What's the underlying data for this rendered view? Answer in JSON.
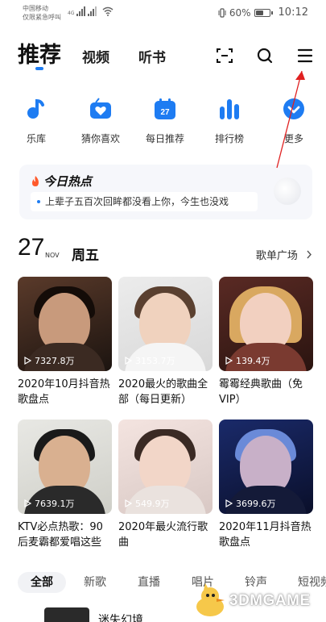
{
  "status_bar": {
    "carrier_line1": "中国移动",
    "carrier_line2": "仅限紧急呼叫",
    "signal_badge": "4G",
    "battery_percent": "60%",
    "time": "10:12"
  },
  "nav": {
    "tabs": [
      {
        "label": "推荐",
        "active": true
      },
      {
        "label": "视频",
        "active": false
      },
      {
        "label": "听书",
        "active": false
      }
    ],
    "icons": [
      "scan-icon",
      "search-icon",
      "menu-icon"
    ]
  },
  "quick_entries": [
    {
      "label": "乐库",
      "icon": "music-note-icon"
    },
    {
      "label": "猜你喜欢",
      "icon": "heart-radio-icon"
    },
    {
      "label": "每日推荐",
      "icon": "calendar-icon",
      "badge": "27"
    },
    {
      "label": "排行榜",
      "icon": "bar-chart-icon"
    },
    {
      "label": "更多",
      "icon": "chevron-down-icon"
    }
  ],
  "hot_today": {
    "title": "今日热点",
    "item": "上辈子五百次回眸都没看上你，今生也没戏"
  },
  "date_header": {
    "day": "27",
    "month": "NOV",
    "weekday": "周五",
    "link": "歌单广场"
  },
  "playlists": [
    {
      "count": "7327.8万",
      "title": "2020年10月抖音热歌盘点"
    },
    {
      "count": "3153.7万",
      "title": "2020最火的歌曲全部（每日更新）"
    },
    {
      "count": "139.4万",
      "title": "霉霉经典歌曲（免VIP）"
    },
    {
      "count": "7639.1万",
      "title": "KTV必点热歌：90后麦霸都爱唱这些"
    },
    {
      "count": "549.9万",
      "title": "2020年最火流行歌曲"
    },
    {
      "count": "3699.6万",
      "title": "2020年11月抖音热歌盘点"
    }
  ],
  "categories": [
    "全部",
    "新歌",
    "直播",
    "唱片",
    "铃声",
    "短视频"
  ],
  "bottom_item": {
    "title": "迷失幻境"
  },
  "watermark": {
    "text": "3DMGAME"
  },
  "colors": {
    "accent": "#1e7cf2",
    "hot": "#ff5a2c",
    "annotation": "#e02020"
  }
}
